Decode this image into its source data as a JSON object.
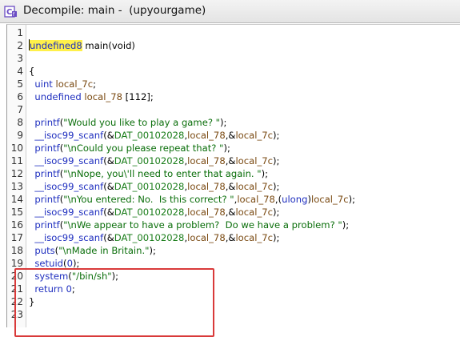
{
  "window": {
    "title": "Decompile: main -  (upyourgame)",
    "icon": "decompile-icon"
  },
  "editor": {
    "line_numbers": [
      "1",
      "2",
      "3",
      "4",
      "5",
      "6",
      "7",
      "8",
      "9",
      "10",
      "11",
      "12",
      "13",
      "14",
      "15",
      "16",
      "17",
      "18",
      "19",
      "20",
      "21",
      "22",
      "23"
    ],
    "code": {
      "l2_type": "undefined8",
      "l2_rest": " main(void)",
      "l4": "{",
      "l5_type": "uint",
      "l5_var": "local_7c",
      "l6_type": "undefined",
      "l6_var": "local_78",
      "l6_rest": " [112];",
      "l8_fn": "printf",
      "l8_str": "\"Would you like to play a game? \"",
      "l9_fn": "__isoc99_scanf",
      "l9_glob": "DAT_00102028",
      "l9_v1": "local_78",
      "l9_v2": "local_7c",
      "l10_fn": "printf",
      "l10_str": "\"\\nCould you please repeat that? \"",
      "l11_fn": "__isoc99_scanf",
      "l11_glob": "DAT_00102028",
      "l11_v1": "local_78",
      "l11_v2": "local_7c",
      "l12_fn": "printf",
      "l12_str": "\"\\nNope, you\\'ll need to enter that again. \"",
      "l13_fn": "__isoc99_scanf",
      "l13_glob": "DAT_00102028",
      "l13_v1": "local_78",
      "l13_v2": "local_7c",
      "l14_fn": "printf",
      "l14_str": "\"\\nYou entered: No.  Is this correct? \"",
      "l14_v1": "local_78",
      "l14_cast": "ulong",
      "l14_v2": "local_7c",
      "l15_fn": "__isoc99_scanf",
      "l15_glob": "DAT_00102028",
      "l15_v1": "local_78",
      "l15_v2": "local_7c",
      "l16_fn": "printf",
      "l16_str": "\"\\nWe appear to have a problem?  Do we have a problem? \"",
      "l17_fn": "__isoc99_scanf",
      "l17_glob": "DAT_00102028",
      "l17_v1": "local_78",
      "l17_v2": "local_7c",
      "l18_fn": "puts",
      "l18_str": "\"\\nMade in Britain.\"",
      "l19_fn": "setuid",
      "l19_num": "0",
      "l20_fn": "system",
      "l20_str": "\"/bin/sh\"",
      "l21_kw": "return",
      "l21_num": "0",
      "l22": "}"
    },
    "highlight_color": "#fff04a",
    "annotation_box_color": "#d93a3a"
  }
}
